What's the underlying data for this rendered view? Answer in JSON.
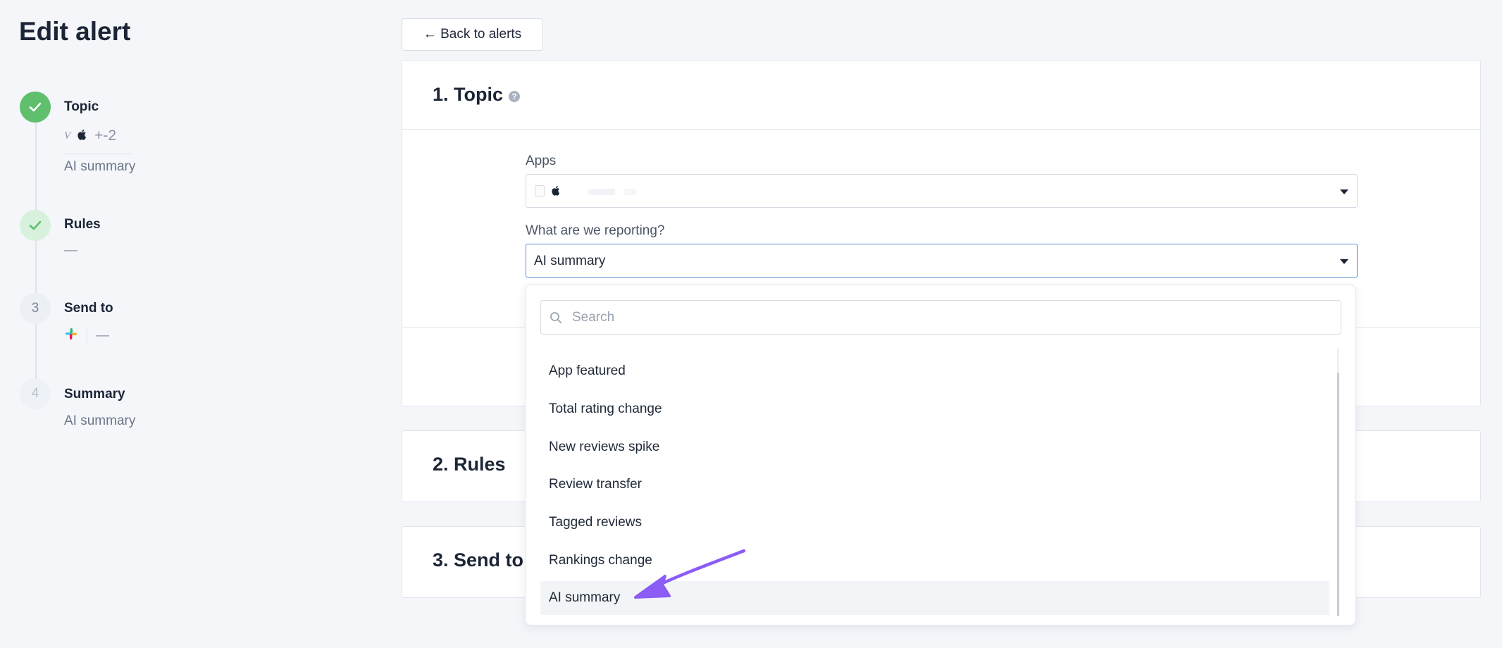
{
  "page": {
    "title": "Edit alert"
  },
  "steps": [
    {
      "title": "Topic",
      "apps_more": "+-2",
      "summary": "AI summary"
    },
    {
      "title": "Rules",
      "summary": "—"
    },
    {
      "number": "3",
      "title": "Send to",
      "summary": "—"
    },
    {
      "number": "4",
      "title": "Summary",
      "summary": "AI summary"
    }
  ],
  "back_button": {
    "label": "← Back to alerts"
  },
  "topic_card": {
    "title": "1. Topic",
    "apps_label": "Apps",
    "reporting_label": "What are we reporting?",
    "reporting_value": "AI summary"
  },
  "rules_card": {
    "title": "2. Rules"
  },
  "send_card": {
    "title": "3. Send to"
  },
  "dropdown": {
    "search_placeholder": "Search",
    "options": [
      "App featured",
      "Total rating change",
      "New reviews spike",
      "Review transfer",
      "Tagged reviews",
      "Rankings change",
      "AI summary"
    ],
    "selected": "AI summary"
  },
  "colors": {
    "done": "#5fbf6c",
    "accent_border": "#5b8fd6",
    "annotation_arrow": "#8b5cf6"
  }
}
